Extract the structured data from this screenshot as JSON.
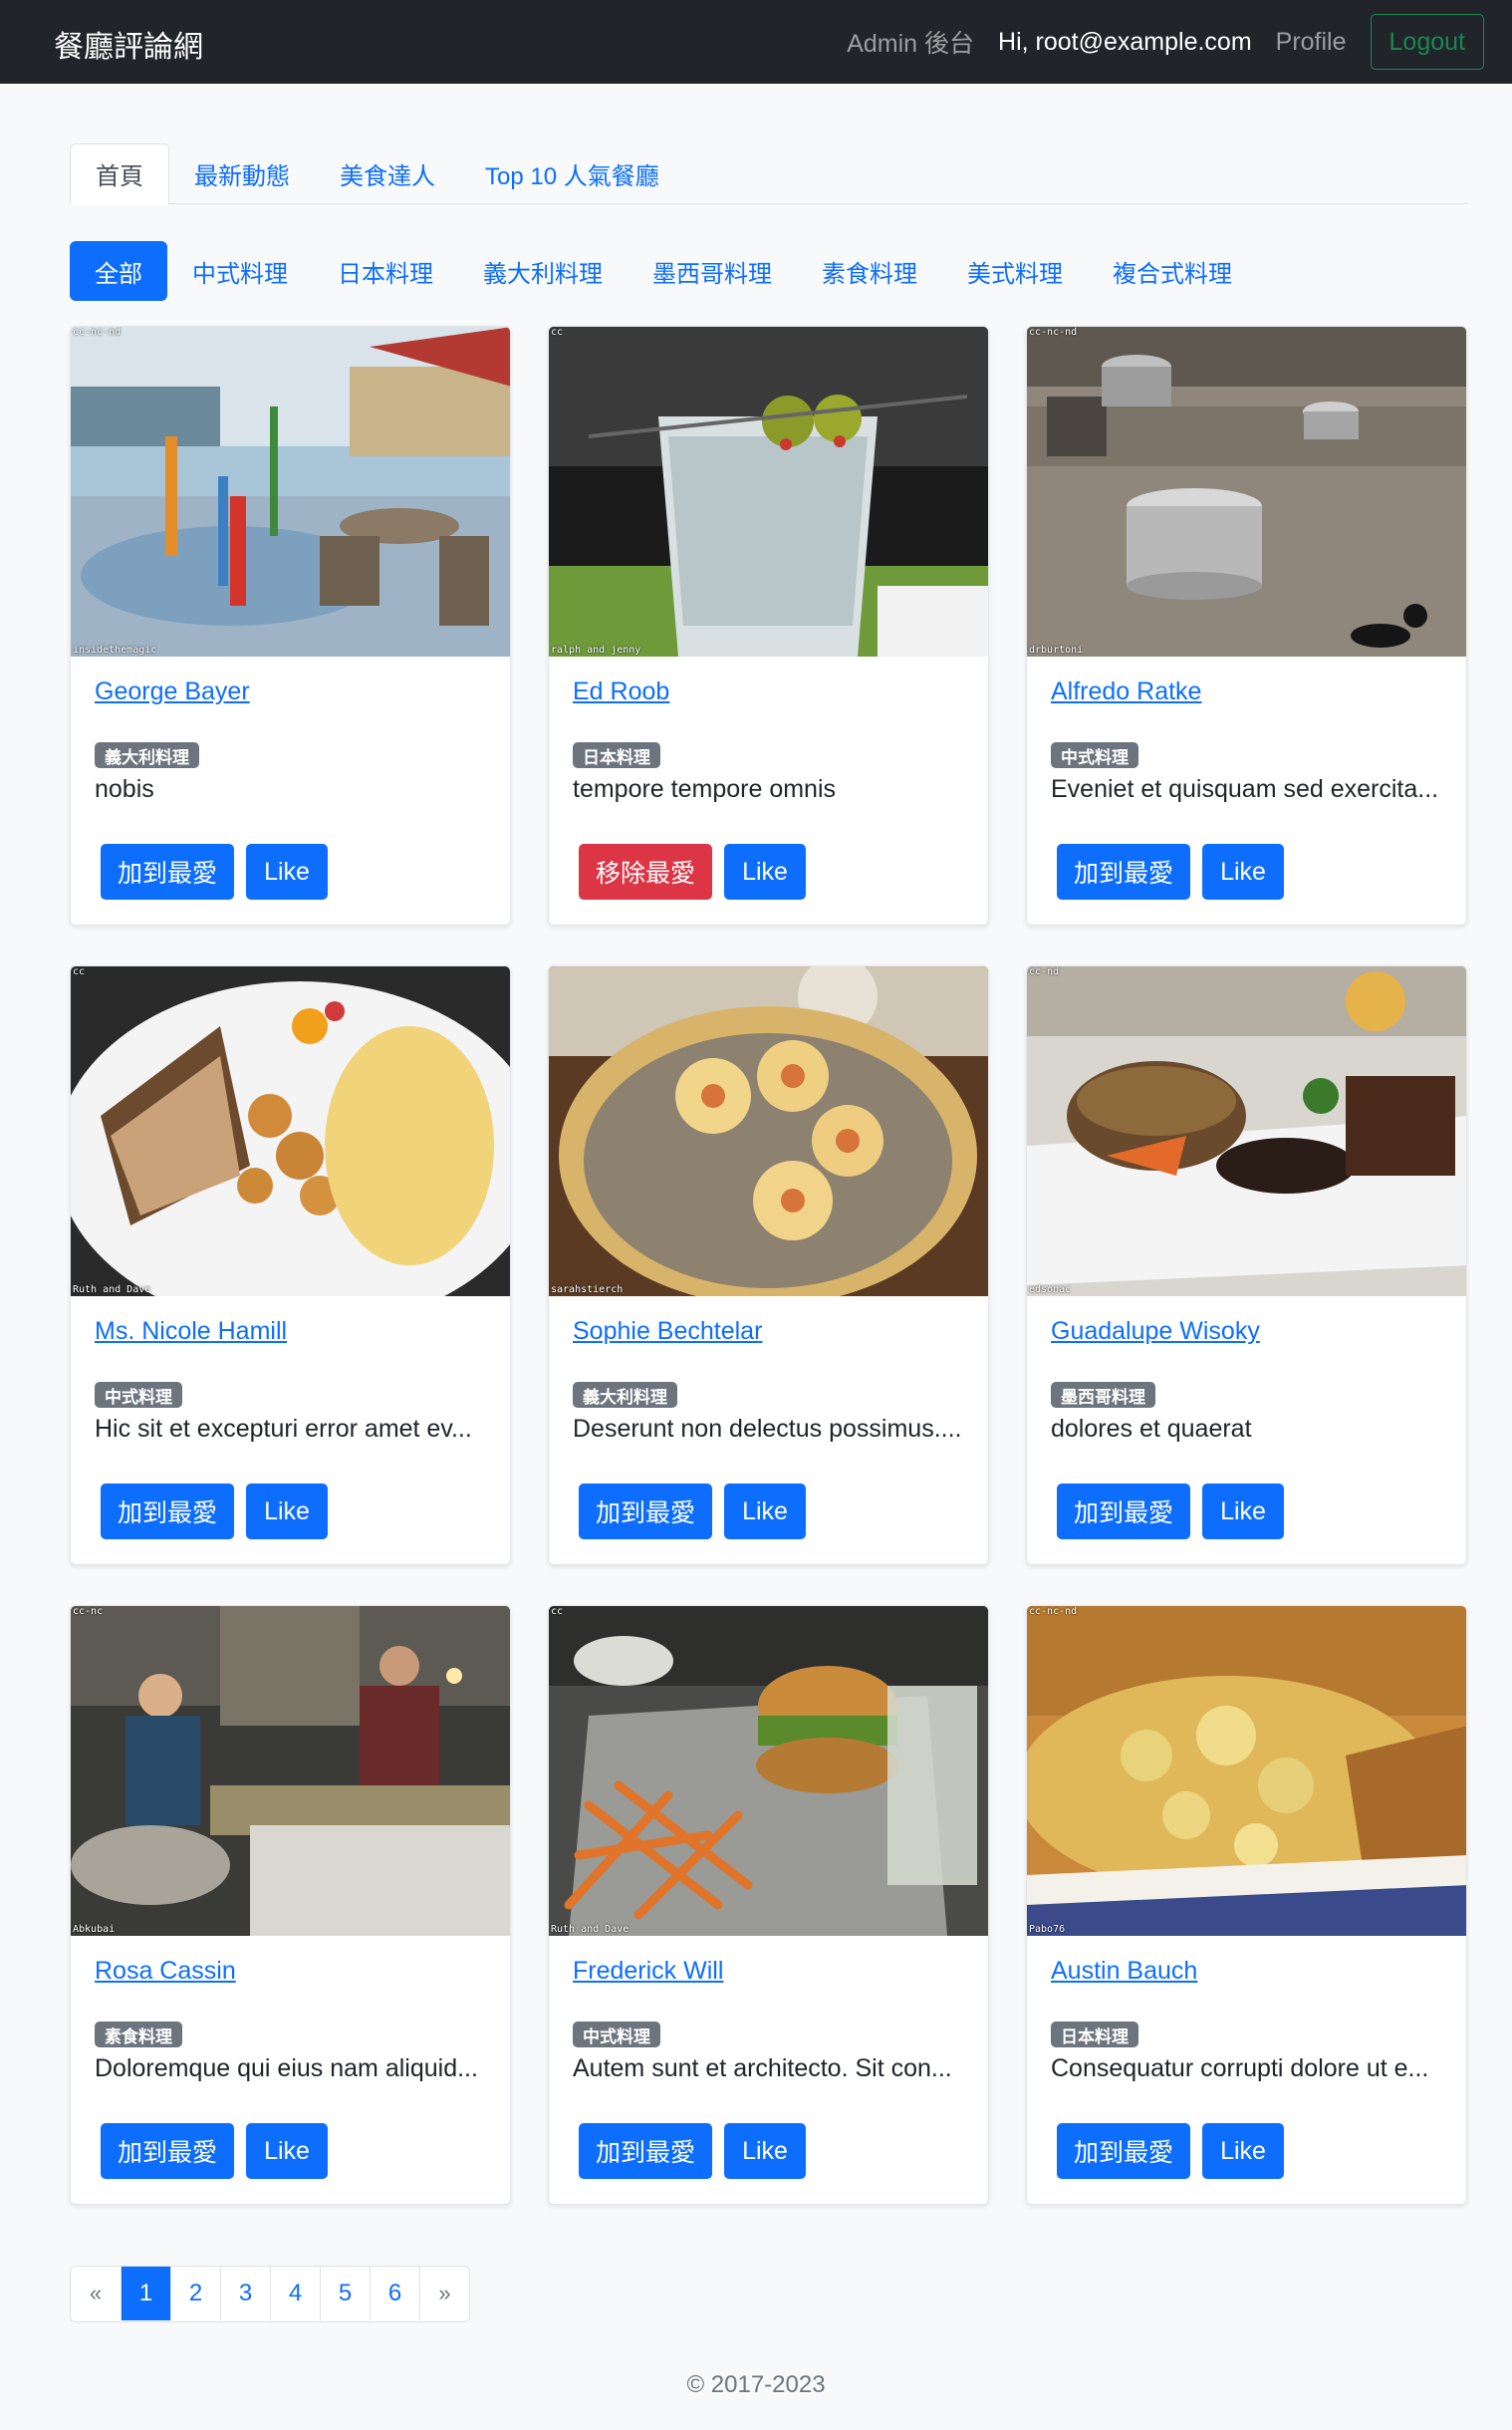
{
  "navbar": {
    "brand": "餐廳評論網",
    "admin": "Admin 後台",
    "greeting": "Hi, root@example.com",
    "profile": "Profile",
    "logout": "Logout"
  },
  "tabs": [
    {
      "label": "首頁",
      "active": true
    },
    {
      "label": "最新動態",
      "active": false
    },
    {
      "label": "美食達人",
      "active": false
    },
    {
      "label": "Top 10 人氣餐廳",
      "active": false
    }
  ],
  "categories": [
    {
      "label": "全部",
      "active": true
    },
    {
      "label": "中式料理"
    },
    {
      "label": "日本料理"
    },
    {
      "label": "義大利料理"
    },
    {
      "label": "墨西哥料理"
    },
    {
      "label": "素食料理"
    },
    {
      "label": "美式料理"
    },
    {
      "label": "複合式料理"
    }
  ],
  "restaurants": [
    {
      "name": "George Bayer",
      "category": "義大利料理",
      "description": "nobis",
      "fav_label": "加到最愛",
      "like_label": "Like",
      "license": "cc-nc-nd",
      "credit": "insidethemagic"
    },
    {
      "name": "Ed Roob",
      "category": "日本料理",
      "description": "tempore tempore omnis",
      "fav_label": "移除最愛",
      "like_label": "Like",
      "license": "cc",
      "credit": "ralph and jenny"
    },
    {
      "name": "Alfredo Ratke",
      "category": "中式料理",
      "description": "Eveniet et quisquam sed exercita...",
      "fav_label": "加到最愛",
      "like_label": "Like",
      "license": "cc-nc-nd",
      "credit": "drburtoni"
    },
    {
      "name": "Ms. Nicole Hamill",
      "category": "中式料理",
      "description": "Hic sit et excepturi error amet ev...",
      "fav_label": "加到最愛",
      "like_label": "Like",
      "license": "cc",
      "credit": "Ruth and Dave"
    },
    {
      "name": "Sophie Bechtelar",
      "category": "義大利料理",
      "description": "Deserunt non delectus possimus....",
      "fav_label": "加到最愛",
      "like_label": "Like",
      "license": "",
      "credit": "sarahstierch"
    },
    {
      "name": "Guadalupe Wisoky",
      "category": "墨西哥料理",
      "description": "dolores et quaerat",
      "fav_label": "加到最愛",
      "like_label": "Like",
      "license": "cc-nd",
      "credit": "edsonac"
    },
    {
      "name": "Rosa Cassin",
      "category": "素食料理",
      "description": "Doloremque qui eius nam aliquid...",
      "fav_label": "加到最愛",
      "like_label": "Like",
      "license": "cc-nc",
      "credit": "Abkubai"
    },
    {
      "name": "Frederick Will",
      "category": "中式料理",
      "description": "Autem sunt et architecto. Sit con...",
      "fav_label": "加到最愛",
      "like_label": "Like",
      "license": "cc",
      "credit": "Ruth and Dave"
    },
    {
      "name": "Austin Bauch",
      "category": "日本料理",
      "description": "Consequatur corrupti dolore ut e...",
      "fav_label": "加到最愛",
      "like_label": "Like",
      "license": "cc-nc-nd",
      "credit": "Pabo76"
    }
  ],
  "pagination": {
    "prev": "«",
    "pages": [
      "1",
      "2",
      "3",
      "4",
      "5",
      "6"
    ],
    "current": "1",
    "next": "»"
  },
  "footer": "© 2017-2023"
}
